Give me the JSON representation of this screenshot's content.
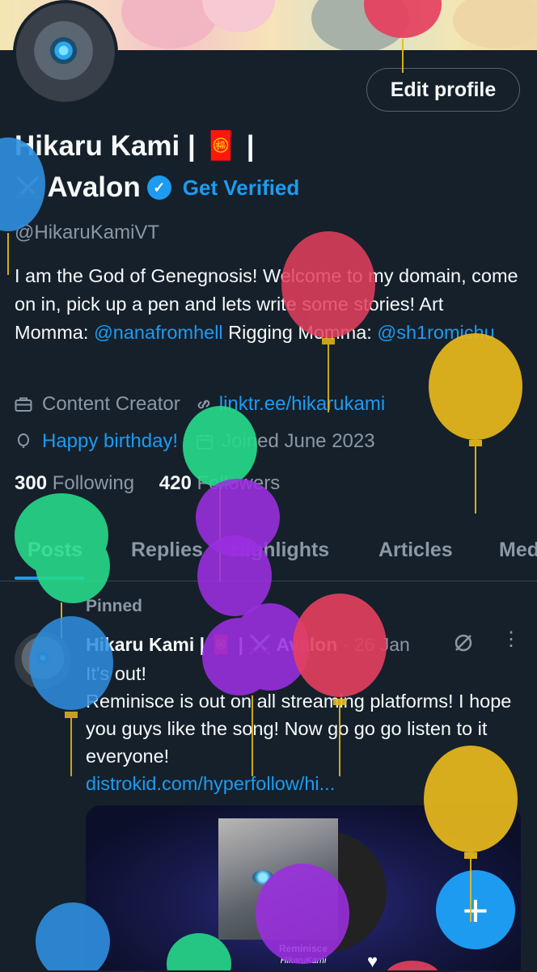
{
  "profile": {
    "edit_label": "Edit profile",
    "name_line1": "Hikaru Kami | 🧧 |",
    "name_line2": "Avalon",
    "name_prefix_emoji": "⚔️",
    "get_verified": "Get Verified",
    "handle": "@HikaruKamiVT",
    "bio": {
      "part1": "I am the God of Genegnosis! Welcome to my domain, come on in, pick up a pen and lets write some stories! Art Momma: ",
      "mention1": "@nanafromhell",
      "part2": " Rigging Momma: ",
      "mention2": "@sh1romichu"
    },
    "category": "Content Creator",
    "link": "linktr.ee/hikarukami",
    "birthday": "Happy birthday!",
    "joined": "Joined June 2023",
    "following_count": "300",
    "following_label": "Following",
    "followers_count": "420",
    "followers_label": "Followers"
  },
  "tabs": [
    "Posts",
    "Replies",
    "Highlights",
    "Articles",
    "Media"
  ],
  "post": {
    "pinned_label": "Pinned",
    "author": "Hikaru Kami | 🧧 | ⚔️ Avalon",
    "date": "· 26 Jan",
    "line1": "It's out!",
    "body": "Reminisce is out on all streaming platforms! I hope you guys like the song! Now go go go listen to it everyone!",
    "link": "distrokid.com/hyperfollow/hi...",
    "album_title": "Reminisce",
    "album_artist": "HikaruKami"
  },
  "fab_label": "+",
  "colors": {
    "background": "#15202b",
    "accent": "#1d9bf0",
    "muted": "#8b98a5",
    "balloon_red": "#e5405e",
    "balloon_yellow": "#e8b91c",
    "balloon_green": "#27d98a",
    "balloon_purple": "#9b2fe0",
    "balloon_blue": "#2f8fe0"
  },
  "icons": [
    "briefcase-icon",
    "link-icon",
    "balloon-birthday-icon",
    "calendar-icon",
    "verified-badge-icon",
    "grok-icon",
    "more-icon",
    "plus-icon",
    "heart-icon"
  ]
}
